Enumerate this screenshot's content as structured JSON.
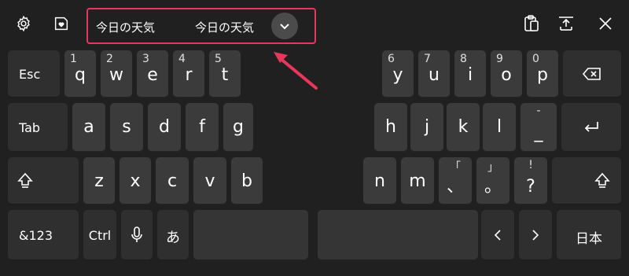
{
  "candidates": {
    "first": "今日の天気",
    "second": "今日の天気",
    "expand_icon": "chevron-down-icon"
  },
  "toolbar": {
    "settings_icon": "gear-icon",
    "emoji_icon": "heart-sticker-icon",
    "clipboard_icon": "clipboard-icon",
    "dock_icon": "dock-keyboard-icon",
    "close_icon": "close-icon"
  },
  "colors": {
    "background": "#202020",
    "key": "#3b3b3b",
    "key_dark": "#2f2f2f",
    "highlight": "#e8365d"
  },
  "keys": {
    "esc": "Esc",
    "q": "q",
    "w": "w",
    "e": "e",
    "r": "r",
    "t": "t",
    "n1": "1",
    "n2": "2",
    "n3": "3",
    "n4": "4",
    "n5": "5",
    "y": "y",
    "u": "u",
    "i": "i",
    "o": "o",
    "p": "p",
    "n6": "6",
    "n7": "7",
    "n8": "8",
    "n9": "9",
    "n0": "0",
    "tab": "Tab",
    "a": "a",
    "s": "s",
    "d": "d",
    "f": "f",
    "g": "g",
    "h": "h",
    "j": "j",
    "k": "k",
    "l": "l",
    "dash_top": "-",
    "dash_main": "_",
    "z": "z",
    "x": "x",
    "c": "c",
    "v": "v",
    "b": "b",
    "n": "n",
    "m": "m",
    "comma_top": "「",
    "comma_main": "、",
    "period_top": "」",
    "period_main": "。",
    "q_top": "!",
    "q_main": "?",
    "sym": "&123",
    "ctrl": "Ctrl",
    "kana": "あ",
    "lang": "日本"
  }
}
